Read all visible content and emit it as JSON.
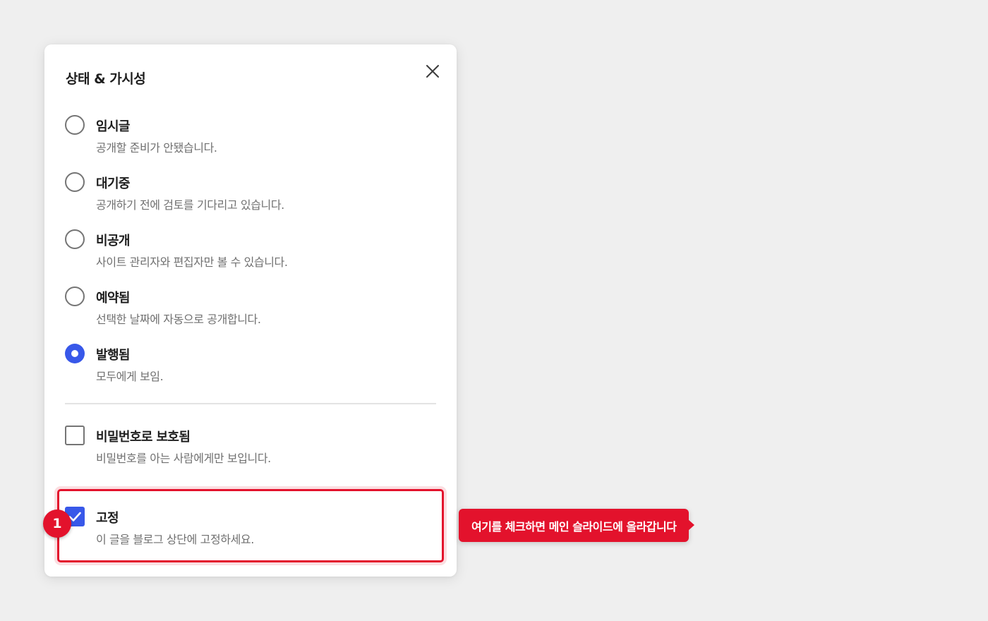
{
  "panel": {
    "title": "상태 & 가시성",
    "close_icon": "close-icon"
  },
  "status_options": [
    {
      "label": "임시글",
      "description": "공개할 준비가 안됐습니다.",
      "selected": false
    },
    {
      "label": "대기중",
      "description": "공개하기 전에 검토를 기다리고 있습니다.",
      "selected": false
    },
    {
      "label": "비공개",
      "description": "사이트 관리자와 편집자만 볼 수 있습니다.",
      "selected": false
    },
    {
      "label": "예약됨",
      "description": "선택한 날짜에 자동으로 공개합니다.",
      "selected": false
    },
    {
      "label": "발행됨",
      "description": "모두에게 보임.",
      "selected": true
    }
  ],
  "password_option": {
    "label": "비밀번호로 보호됨",
    "description": "비밀번호를 아는 사람에게만 보입니다.",
    "checked": false
  },
  "sticky_option": {
    "label": "고정",
    "description": "이 글을 블로그 상단에 고정하세요.",
    "checked": true
  },
  "annotation": {
    "marker": "1",
    "callout": "여기를 체크하면 메인 슬라이드에 올라갑니다",
    "accent_color": "#e3122c"
  },
  "colors": {
    "primary": "#3858e9",
    "background": "#efefef"
  }
}
